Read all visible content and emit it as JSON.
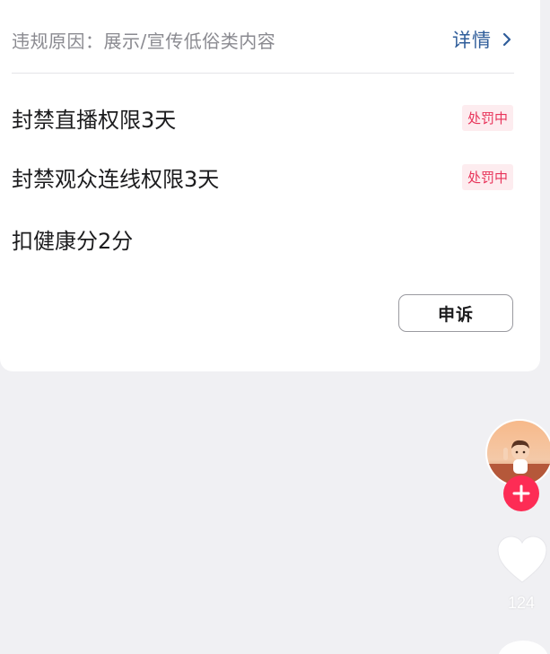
{
  "violation": {
    "reason": "违规原因：展示/宣传低俗类内容",
    "details_label": "详情"
  },
  "penalties": [
    {
      "text": "封禁直播权限3天",
      "status": "处罚中"
    },
    {
      "text": "封禁观众连线权限3天",
      "status": "处罚中"
    },
    {
      "text": "扣健康分2分",
      "status": ""
    }
  ],
  "appeal_label": "申诉",
  "sidebar": {
    "like_count": "124"
  },
  "colors": {
    "link": "#2f5d9a",
    "badge_text": "#e8345a",
    "badge_bg": "#fdecef",
    "follow": "#fd2c55"
  }
}
